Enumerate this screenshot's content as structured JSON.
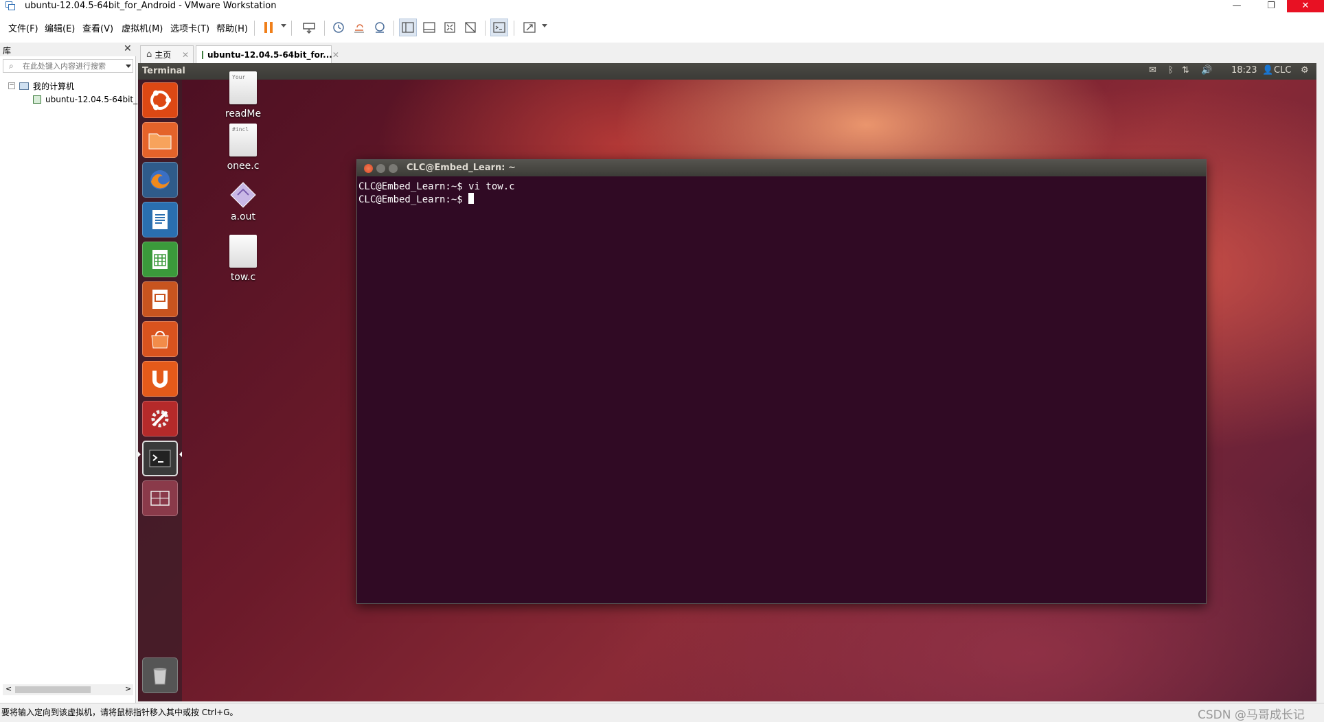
{
  "window": {
    "title": "ubuntu-12.04.5-64bit_for_Android - VMware Workstation",
    "minimize": "—",
    "maximize": "❐",
    "close": "✕"
  },
  "menu": [
    "文件(F)",
    "编辑(E)",
    "查看(V)",
    "虚拟机(M)",
    "选项卡(T)",
    "帮助(H)"
  ],
  "library": {
    "title": "库",
    "close": "✕",
    "search_placeholder": "在此处键入内容进行搜索",
    "tree": {
      "root_label": "我的计算机",
      "root_expander": "−",
      "vm_label": "ubuntu-12.04.5-64bit_"
    },
    "scroll_left": "<",
    "scroll_right": ">"
  },
  "tabs": {
    "home": "主页",
    "vm": "ubuntu-12.04.5-64bit_for...",
    "close": "✕"
  },
  "guest": {
    "panel": {
      "app_name": "Terminal",
      "time": "18:23",
      "user": "CLC"
    },
    "desktop_icons": [
      {
        "label": "readMe",
        "preview": "Your"
      },
      {
        "label": "onee.c",
        "preview": "#incl"
      },
      {
        "label": "a.out",
        "preview": ""
      },
      {
        "label": "tow.c",
        "preview": ""
      }
    ],
    "terminal": {
      "title": "CLC@Embed_Learn: ~",
      "line1": "CLC@Embed_Learn:~$ vi tow.c",
      "prompt": "CLC@Embed_Learn:~$ "
    }
  },
  "status": {
    "message": "要将输入定向到该虚拟机，请将鼠标指针移入其中或按 Ctrl+G。",
    "watermark": "CSDN @马哥成长记"
  },
  "colors": {
    "terminal_bg": "#300a24",
    "ubuntu_panel": "#3c3b37",
    "close_red": "#e81123",
    "accent_orange": "#e95420"
  }
}
